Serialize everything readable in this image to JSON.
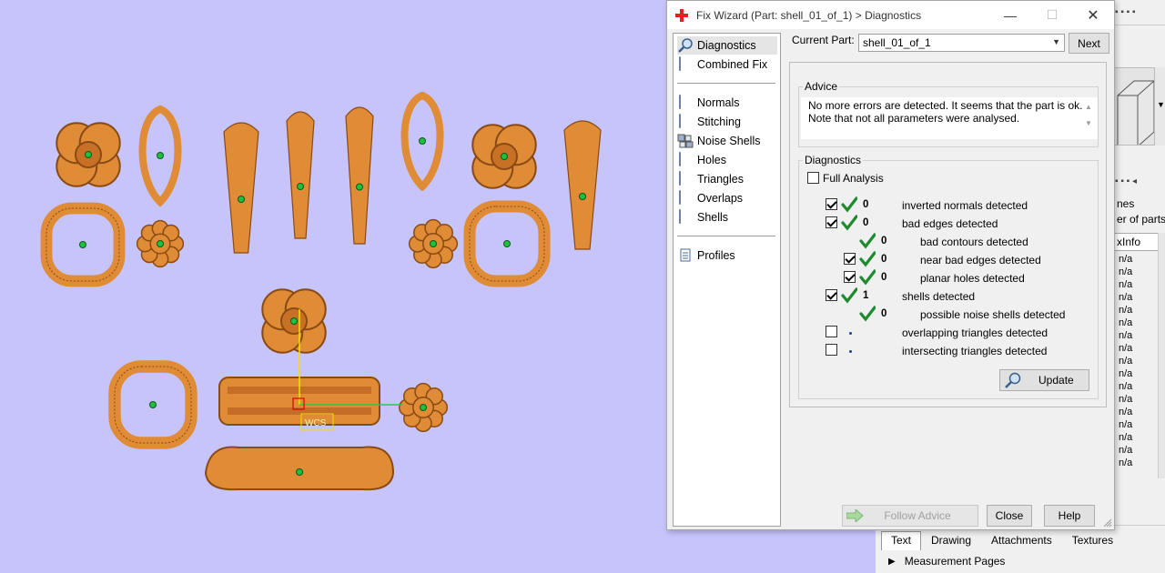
{
  "dialog": {
    "title": "Fix Wizard (Part: shell_01_of_1) > Diagnostics",
    "window_buttons": {
      "minimize": "—",
      "maximize": "☐",
      "close": "✕"
    },
    "nav": {
      "top_items": [
        {
          "label": "Diagnostics",
          "icon": "magnifier-icon",
          "selected": true
        },
        {
          "label": "Combined Fix",
          "icon": "cube-icon",
          "selected": false
        }
      ],
      "fix_items": [
        {
          "label": "Normals",
          "icon": "normals-cube-icon"
        },
        {
          "label": "Stitching",
          "icon": "stitching-cube-icon"
        },
        {
          "label": "Noise Shells",
          "icon": "noise-shells-icon"
        },
        {
          "label": "Holes",
          "icon": "holes-cube-icon"
        },
        {
          "label": "Triangles",
          "icon": "triangles-cube-icon"
        },
        {
          "label": "Overlaps",
          "icon": "overlaps-cube-icon"
        },
        {
          "label": "Shells",
          "icon": "shells-cube-icon"
        }
      ],
      "profiles_label": "Profiles"
    },
    "current_part_label": "Current Part:",
    "current_part_value": "shell_01_of_1",
    "next_label": "Next",
    "advice": {
      "legend": "Advice",
      "line1": "No more errors are detected. It seems that the part is ok.",
      "line2": "Note that not all parameters were analysed."
    },
    "diagnostics": {
      "legend": "Diagnostics",
      "full_analysis_label": "Full Analysis",
      "full_analysis_checked": false,
      "rows": [
        {
          "label": "inverted normals detected",
          "count": "0",
          "checked": true,
          "status": "ok"
        },
        {
          "label": "bad edges detected",
          "count": "0",
          "checked": true,
          "status": "ok"
        },
        {
          "label": "bad contours detected",
          "count": "0",
          "checked": null,
          "status": "ok"
        },
        {
          "label": "near bad edges detected",
          "count": "0",
          "checked": true,
          "status": "ok"
        },
        {
          "label": "planar holes detected",
          "count": "0",
          "checked": true,
          "status": "ok"
        },
        {
          "label": "shells detected",
          "count": "1",
          "checked": true,
          "status": "ok"
        },
        {
          "label": "possible noise shells detected",
          "count": "0",
          "checked": null,
          "status": "ok"
        },
        {
          "label": "overlapping triangles detected",
          "count": "",
          "checked": false,
          "status": "not-run"
        },
        {
          "label": "intersecting triangles detected",
          "count": "",
          "checked": false,
          "status": "not-run"
        }
      ],
      "update_label": "Update"
    },
    "follow_advice_label": "Follow Advice",
    "close_label": "Close",
    "help_label": "Help"
  },
  "background": {
    "panel_text_1": "nes",
    "panel_text_2": "er of parts:",
    "tab_header": "xInfo",
    "row_value": "n/a",
    "row_count": 17,
    "bottom_tabs": [
      "Text",
      "Drawing",
      "Attachments",
      "Textures"
    ],
    "active_bottom_tab": "Text",
    "measurement_pages_label": "Measurement Pages",
    "wcs_label": "WCS"
  },
  "colors": {
    "viewport_bg": "#c6c4fb",
    "model_fill": "#e08b35",
    "model_dark": "#8a4a14",
    "check_green": "#1e8a2e",
    "axis_x": "#22cc44",
    "axis_y": "#f2e000"
  }
}
